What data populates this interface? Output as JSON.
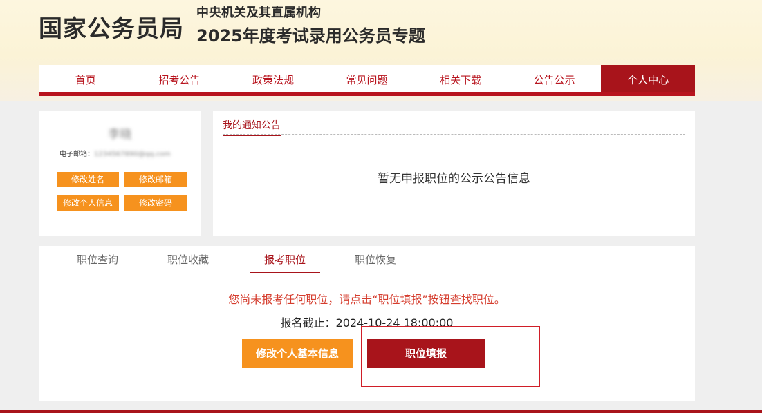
{
  "header": {
    "logo": "国家公务员局",
    "subtitle1": "中央机关及其直属机构",
    "subtitle2": "2025年度考试录用公务员专题"
  },
  "nav": {
    "items": [
      "首页",
      "招考公告",
      "政策法规",
      "常见问题",
      "相关下载",
      "公告公示",
      "个人中心"
    ],
    "active": "个人中心"
  },
  "profile": {
    "name": "李晓",
    "email_label": "电子邮箱：",
    "email_value": "1234567890@qq.com",
    "buttons": [
      "修改姓名",
      "修改邮箱",
      "修改个人信息",
      "修改密码"
    ]
  },
  "notice": {
    "title": "我的通知公告",
    "empty_text": "暂无申报职位的公示公告信息"
  },
  "tabs": {
    "items": [
      "职位查询",
      "职位收藏",
      "报考职位",
      "职位恢复"
    ],
    "active": "报考职位"
  },
  "main": {
    "warning": "您尚未报考任何职位，请点击“职位填报”按钮查找职位。",
    "deadline": "报名截止：2024-10-24 18:00:00",
    "edit_info_button": "修改个人基本信息",
    "apply_button": "职位填报"
  },
  "colors": {
    "brand_red": "#a8141b",
    "accent_orange": "#f6921e",
    "warning_red": "#d53d2e"
  }
}
